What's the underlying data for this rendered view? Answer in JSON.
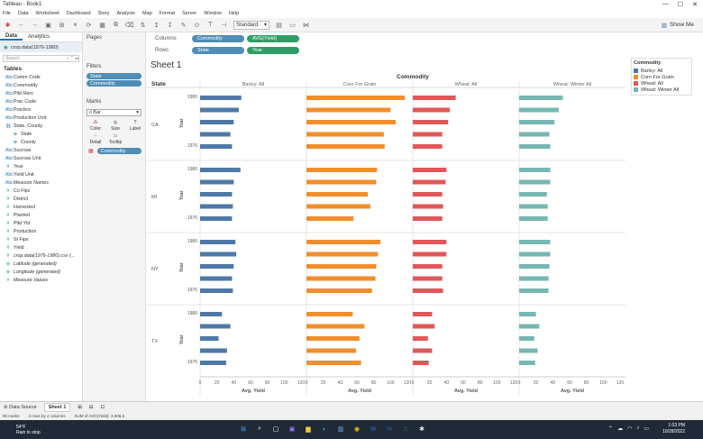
{
  "window": {
    "title": "Tableau - Book1",
    "minimize": "—",
    "maximize": "☐",
    "close": "✕"
  },
  "menu": [
    "File",
    "Data",
    "Worksheet",
    "Dashboard",
    "Story",
    "Analysis",
    "Map",
    "Format",
    "Server",
    "Window",
    "Help"
  ],
  "toolbar": {
    "fit": "Standard",
    "show_me": "Show Me"
  },
  "data_pane": {
    "tabs": [
      "Data",
      "Analytics"
    ],
    "source": "crop.data(1976-1980)",
    "search_placeholder": "Search",
    "tables_header": "Tables",
    "fields": [
      {
        "name": "Comm Code",
        "kind": "dim",
        "icon": "Abc",
        "indent": false,
        "italic": false
      },
      {
        "name": "Commodity",
        "kind": "dim",
        "icon": "Abc",
        "indent": false,
        "italic": false
      },
      {
        "name": "Pltd Harv",
        "kind": "dim",
        "icon": "Abc",
        "indent": false,
        "italic": false
      },
      {
        "name": "Prac Code",
        "kind": "dim",
        "icon": "Abc",
        "indent": false,
        "italic": false
      },
      {
        "name": "Practice",
        "kind": "dim",
        "icon": "Abc",
        "indent": false,
        "italic": false
      },
      {
        "name": "Production Unit",
        "kind": "dim",
        "icon": "Abc",
        "indent": false,
        "italic": false
      },
      {
        "name": "State, County",
        "kind": "dim",
        "icon": "⛓",
        "indent": false,
        "italic": false
      },
      {
        "name": "State",
        "kind": "dim",
        "icon": "⊕",
        "indent": true,
        "italic": false
      },
      {
        "name": "County",
        "kind": "dim",
        "icon": "⊕",
        "indent": true,
        "italic": false
      },
      {
        "name": "Sucrose",
        "kind": "dim",
        "icon": "Abc",
        "indent": false,
        "italic": false
      },
      {
        "name": "Sucrose Unit",
        "kind": "dim",
        "icon": "Abc",
        "indent": false,
        "italic": false
      },
      {
        "name": "Year",
        "kind": "dim",
        "icon": "#",
        "indent": false,
        "italic": false
      },
      {
        "name": "Yield Unit",
        "kind": "dim",
        "icon": "Abc",
        "indent": false,
        "italic": false
      },
      {
        "name": "Measure Names",
        "kind": "dim",
        "icon": "Abc",
        "indent": false,
        "italic": true
      },
      {
        "name": "Co Fips",
        "kind": "mea",
        "icon": "#",
        "indent": false,
        "italic": false
      },
      {
        "name": "District",
        "kind": "mea",
        "icon": "#",
        "indent": false,
        "italic": false
      },
      {
        "name": "Harvested",
        "kind": "mea",
        "icon": "#",
        "indent": false,
        "italic": false
      },
      {
        "name": "Planted",
        "kind": "mea",
        "icon": "#",
        "indent": false,
        "italic": false
      },
      {
        "name": "Pltd Yld",
        "kind": "mea",
        "icon": "#",
        "indent": false,
        "italic": false
      },
      {
        "name": "Production",
        "kind": "mea",
        "icon": "#",
        "indent": false,
        "italic": false
      },
      {
        "name": "St Fips",
        "kind": "mea",
        "icon": "#",
        "indent": false,
        "italic": false
      },
      {
        "name": "Yield",
        "kind": "mea",
        "icon": "#",
        "indent": false,
        "italic": false
      },
      {
        "name": "crop.data(1976-1980).csv (...",
        "kind": "mea",
        "icon": "#",
        "indent": false,
        "italic": true
      },
      {
        "name": "Latitude (generated)",
        "kind": "mea",
        "icon": "⊕",
        "indent": false,
        "italic": true
      },
      {
        "name": "Longitude (generated)",
        "kind": "mea",
        "icon": "⊕",
        "indent": false,
        "italic": true
      },
      {
        "name": "Measure Values",
        "kind": "mea",
        "icon": "#",
        "indent": false,
        "italic": true
      }
    ]
  },
  "cards": {
    "pages": "Pages",
    "filters": "Filters",
    "filter_pills": [
      "State",
      "Commodity"
    ],
    "marks": "Marks",
    "mark_type": "Bar",
    "mark_buttons": [
      "Color",
      "Size",
      "Label",
      "Detail",
      "Tooltip"
    ],
    "color_pill": "Commodity"
  },
  "shelves": {
    "columns_label": "Columns",
    "rows_label": "Rows",
    "columns": [
      "Commodity",
      "AVG(Yield)"
    ],
    "rows": [
      "State",
      "Year"
    ]
  },
  "sheet_title": "Sheet 1",
  "legend": {
    "title": "Commodity",
    "items": [
      {
        "name": "Barley: All",
        "color": "#4e79a7"
      },
      {
        "name": "Corn For Grain",
        "color": "#f28e2b"
      },
      {
        "name": "Wheat: All",
        "color": "#e15759"
      },
      {
        "name": "Wheat: Winter All",
        "color": "#76b7b2"
      }
    ]
  },
  "bottom": {
    "data_source": "Data Source",
    "sheet": "Sheet 1"
  },
  "status": {
    "marks": "80 marks",
    "rows": "4 rows by 4 columns",
    "sum": "SUM of AVG(Yield): 3,906.6"
  },
  "taskbar": {
    "temp": "54°F",
    "weather": "Rain to stop",
    "time": "1:03 PM",
    "date": "10/28/2022"
  },
  "chart_data": {
    "type": "bar",
    "title": "Sheet 1",
    "header": "Commodity",
    "row_header": "State",
    "year_label": "Year",
    "xlabel": "Avg. Yield",
    "xlim": [
      0,
      120
    ],
    "ticks": [
      0,
      20,
      40,
      60,
      80,
      100,
      120
    ],
    "commodities": [
      "Barley: All",
      "Corn For Grain",
      "Wheat: All",
      "Wheat: Winter All"
    ],
    "colors": [
      "#4e79a7",
      "#f28e2b",
      "#e15759",
      "#76b7b2"
    ],
    "states": [
      "CA",
      "MI",
      "NY",
      "TX"
    ],
    "years": [
      "1980",
      "",
      "",
      "",
      "1976"
    ],
    "values": {
      "CA": [
        [
          49,
          117,
          51,
          52
        ],
        [
          46,
          100,
          44,
          47
        ],
        [
          40,
          106,
          42,
          42
        ],
        [
          36,
          92,
          35,
          36
        ],
        [
          38,
          93,
          35,
          37
        ]
      ],
      "MI": [
        [
          48,
          84,
          40,
          37
        ],
        [
          40,
          83,
          39,
          37
        ],
        [
          38,
          73,
          35,
          33
        ],
        [
          39,
          76,
          36,
          34
        ],
        [
          38,
          56,
          35,
          34
        ]
      ],
      "NY": [
        [
          42,
          88,
          40,
          37
        ],
        [
          43,
          85,
          40,
          37
        ],
        [
          40,
          83,
          35,
          36
        ],
        [
          38,
          82,
          35,
          35
        ],
        [
          39,
          78,
          36,
          35
        ]
      ],
      "TX": [
        [
          26,
          55,
          23,
          20
        ],
        [
          36,
          69,
          26,
          24
        ],
        [
          22,
          63,
          18,
          18
        ],
        [
          32,
          59,
          23,
          22
        ],
        [
          31,
          65,
          19,
          19
        ]
      ]
    }
  }
}
